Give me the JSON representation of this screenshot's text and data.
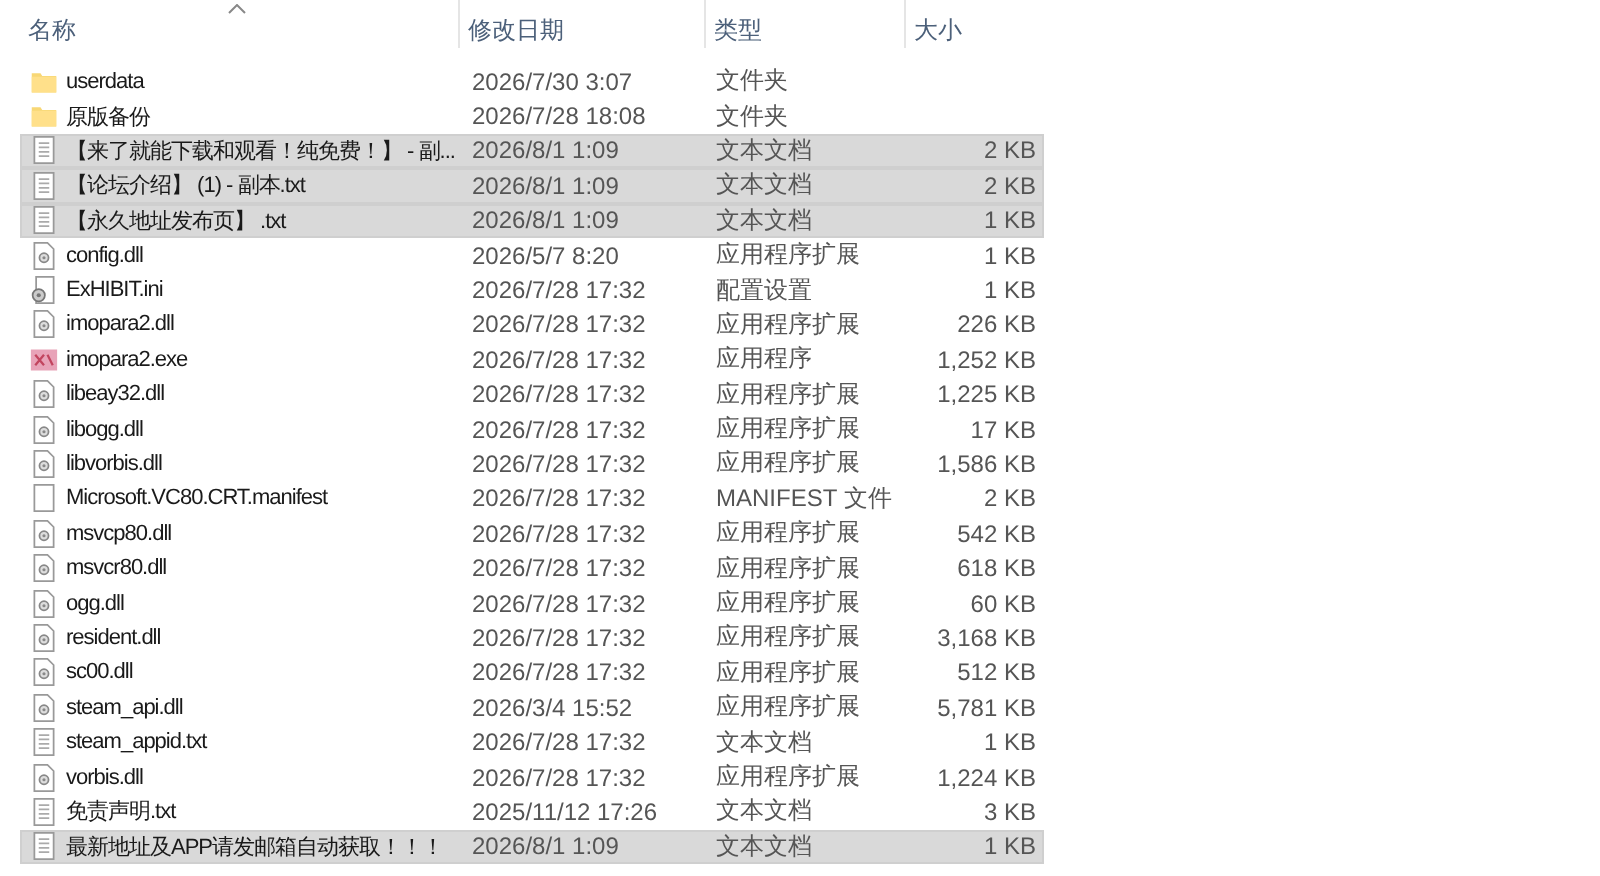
{
  "columns": [
    {
      "label": "名称",
      "sorted": true
    },
    {
      "label": "修改日期",
      "sorted": false
    },
    {
      "label": "类型",
      "sorted": false
    },
    {
      "label": "大小",
      "sorted": false
    }
  ],
  "rows": [
    {
      "kind": "folder",
      "name": "userdata",
      "date": "2026/7/30 3:07",
      "type": "文件夹",
      "selected": false
    },
    {
      "kind": "folder",
      "name": "原版备份",
      "date": "2026/7/28 18:08",
      "type": "文件夹",
      "selected": false
    },
    {
      "kind": "txt",
      "name": "【来了就能下载和观看！纯免费！】 - 副...",
      "date": "2026/8/1 1:09",
      "type": "文本文档",
      "size": "2 KB",
      "selected": true
    },
    {
      "kind": "txt",
      "name": "【论坛介绍】 (1) - 副本.txt",
      "date": "2026/8/1 1:09",
      "type": "文本文档",
      "size": "2 KB",
      "selected": true
    },
    {
      "kind": "txt",
      "name": "【永久地址发布页】 .txt",
      "date": "2026/8/1 1:09",
      "type": "文本文档",
      "size": "1 KB",
      "selected": true
    },
    {
      "kind": "dll",
      "name": "config.dll",
      "date": "2026/5/7 8:20",
      "type": "应用程序扩展",
      "size": "1 KB",
      "selected": false
    },
    {
      "kind": "ini",
      "name": "ExHIBIT.ini",
      "date": "2026/7/28 17:32",
      "type": "配置设置",
      "size": "1 KB",
      "selected": false
    },
    {
      "kind": "dll",
      "name": "imopara2.dll",
      "date": "2026/7/28 17:32",
      "type": "应用程序扩展",
      "size": "226 KB",
      "selected": false
    },
    {
      "kind": "exe",
      "name": "imopara2.exe",
      "date": "2026/7/28 17:32",
      "type": "应用程序",
      "size": "1,252 KB",
      "selected": false
    },
    {
      "kind": "dll",
      "name": "libeay32.dll",
      "date": "2026/7/28 17:32",
      "type": "应用程序扩展",
      "size": "1,225 KB",
      "selected": false
    },
    {
      "kind": "dll",
      "name": "libogg.dll",
      "date": "2026/7/28 17:32",
      "type": "应用程序扩展",
      "size": "17 KB",
      "selected": false
    },
    {
      "kind": "dll",
      "name": "libvorbis.dll",
      "date": "2026/7/28 17:32",
      "type": "应用程序扩展",
      "size": "1,586 KB",
      "selected": false
    },
    {
      "kind": "file",
      "name": "Microsoft.VC80.CRT.manifest",
      "date": "2026/7/28 17:32",
      "type": "MANIFEST 文件",
      "size": "2 KB",
      "selected": false
    },
    {
      "kind": "dll",
      "name": "msvcp80.dll",
      "date": "2026/7/28 17:32",
      "type": "应用程序扩展",
      "size": "542 KB",
      "selected": false
    },
    {
      "kind": "dll",
      "name": "msvcr80.dll",
      "date": "2026/7/28 17:32",
      "type": "应用程序扩展",
      "size": "618 KB",
      "selected": false
    },
    {
      "kind": "dll",
      "name": "ogg.dll",
      "date": "2026/7/28 17:32",
      "type": "应用程序扩展",
      "size": "60 KB",
      "selected": false
    },
    {
      "kind": "dll",
      "name": "resident.dll",
      "date": "2026/7/28 17:32",
      "type": "应用程序扩展",
      "size": "3,168 KB",
      "selected": false
    },
    {
      "kind": "dll",
      "name": "sc00.dll",
      "date": "2026/7/28 17:32",
      "type": "应用程序扩展",
      "size": "512 KB",
      "selected": false
    },
    {
      "kind": "dll",
      "name": "steam_api.dll",
      "date": "2026/3/4 15:52",
      "type": "应用程序扩展",
      "size": "5,781 KB",
      "selected": false
    },
    {
      "kind": "txt",
      "name": "steam_appid.txt",
      "date": "2026/7/28 17:32",
      "type": "文本文档",
      "size": "1 KB",
      "selected": false
    },
    {
      "kind": "dll",
      "name": "vorbis.dll",
      "date": "2026/7/28 17:32",
      "type": "应用程序扩展",
      "size": "1,224 KB",
      "selected": false
    },
    {
      "kind": "txt",
      "name": "免责声明.txt",
      "date": "2025/11/12 17:26",
      "type": "文本文档",
      "size": "3 KB",
      "selected": false
    },
    {
      "kind": "txt",
      "name": "最新地址及APP请发邮箱自动获取！！！",
      "date": "2026/8/1 1:09",
      "type": "文本文档",
      "size": "1 KB",
      "selected": true
    }
  ]
}
